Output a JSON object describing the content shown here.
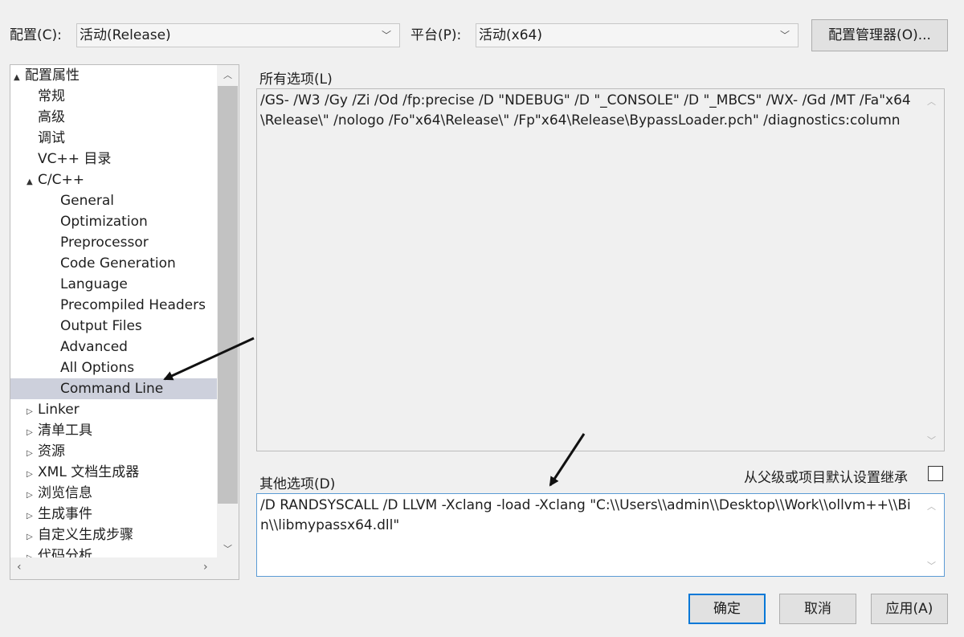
{
  "config": {
    "config_label": "配置(C):",
    "config_value": "活动(Release)",
    "platform_label": "平台(P):",
    "platform_value": "活动(x64)",
    "manager_button": "配置管理器(O)..."
  },
  "tree": {
    "items": [
      {
        "label": "配置属性",
        "indent": 0,
        "toggle": "▲"
      },
      {
        "label": "常规",
        "indent": 1,
        "toggle": ""
      },
      {
        "label": "高级",
        "indent": 1,
        "toggle": ""
      },
      {
        "label": "调试",
        "indent": 1,
        "toggle": ""
      },
      {
        "label": "VC++ 目录",
        "indent": 1,
        "toggle": ""
      },
      {
        "label": "C/C++",
        "indent": 1,
        "toggle": "▲"
      },
      {
        "label": "General",
        "indent": 2,
        "toggle": ""
      },
      {
        "label": "Optimization",
        "indent": 2,
        "toggle": ""
      },
      {
        "label": "Preprocessor",
        "indent": 2,
        "toggle": ""
      },
      {
        "label": "Code Generation",
        "indent": 2,
        "toggle": ""
      },
      {
        "label": "Language",
        "indent": 2,
        "toggle": ""
      },
      {
        "label": "Precompiled Headers",
        "indent": 2,
        "toggle": ""
      },
      {
        "label": "Output Files",
        "indent": 2,
        "toggle": ""
      },
      {
        "label": "Advanced",
        "indent": 2,
        "toggle": ""
      },
      {
        "label": "All Options",
        "indent": 2,
        "toggle": ""
      },
      {
        "label": "Command Line",
        "indent": 2,
        "toggle": "",
        "selected": true
      },
      {
        "label": "Linker",
        "indent": 1,
        "toggle": "▷"
      },
      {
        "label": "清单工具",
        "indent": 1,
        "toggle": "▷"
      },
      {
        "label": "资源",
        "indent": 1,
        "toggle": "▷"
      },
      {
        "label": "XML 文档生成器",
        "indent": 1,
        "toggle": "▷"
      },
      {
        "label": "浏览信息",
        "indent": 1,
        "toggle": "▷"
      },
      {
        "label": "生成事件",
        "indent": 1,
        "toggle": "▷"
      },
      {
        "label": "自定义生成步骤",
        "indent": 1,
        "toggle": "▷"
      },
      {
        "label": "代码分析",
        "indent": 1,
        "toggle": "▷"
      }
    ]
  },
  "all_options": {
    "label": "所有选项(L)",
    "text": "/GS- /W3 /Gy /Zi /Od /fp:precise /D \"NDEBUG\" /D \"_CONSOLE\" /D \"_MBCS\" /WX- /Gd /MT /Fa\"x64\\Release\\\" /nologo /Fo\"x64\\Release\\\" /Fp\"x64\\Release\\BypassLoader.pch\" /diagnostics:column"
  },
  "other_options": {
    "label": "其他选项(D)",
    "inherit_label": "从父级或项目默认设置继承",
    "text": "/D RANDSYSCALL /D LLVM -Xclang -load -Xclang \"C:\\\\Users\\\\admin\\\\Desktop\\\\Work\\\\ollvm++\\\\Bin\\\\libmypassx64.dll\""
  },
  "buttons": {
    "ok": "确定",
    "cancel": "取消",
    "apply": "应用(A)"
  },
  "icons": {
    "combo_chevron": "chevron-down-icon",
    "annotation_arrow": "arrow-icon"
  }
}
